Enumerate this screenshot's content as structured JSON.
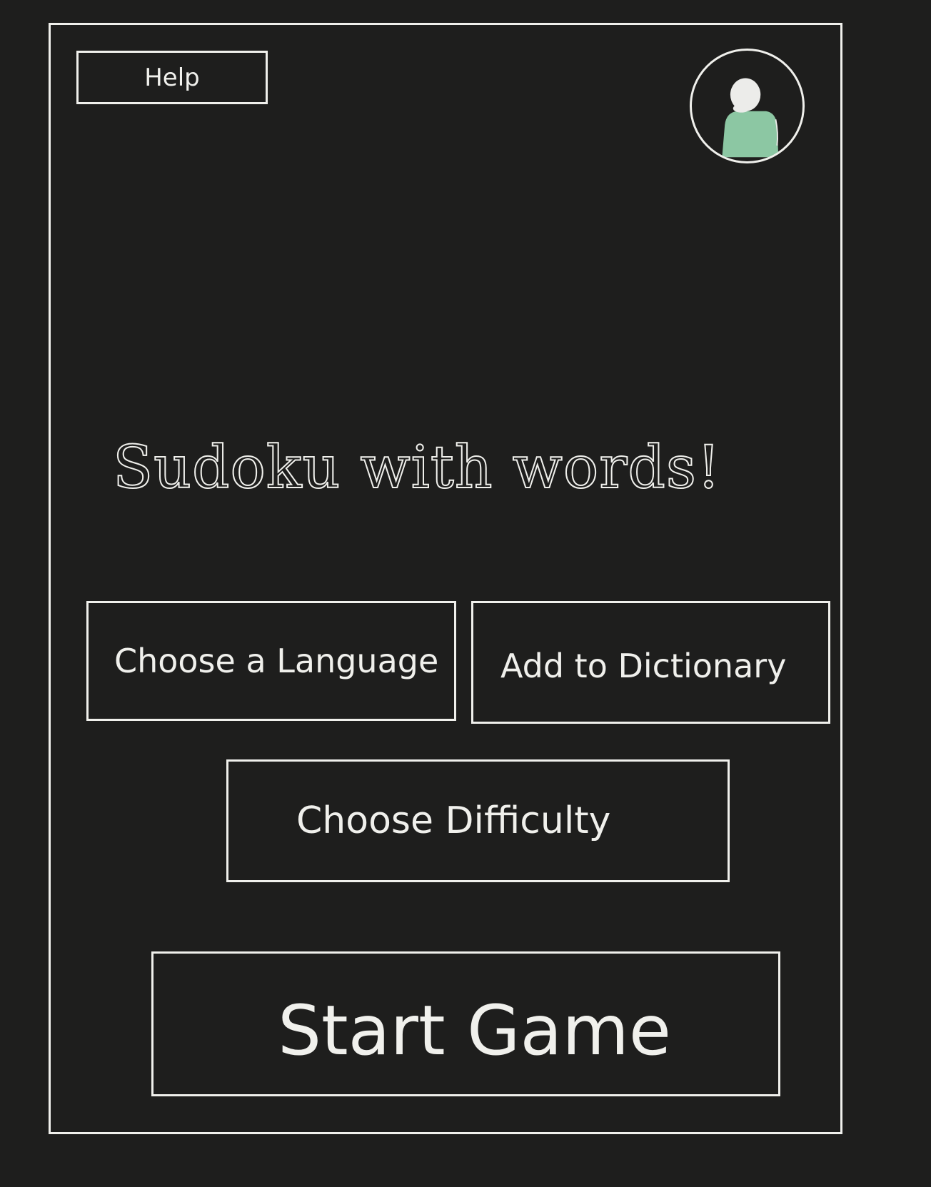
{
  "header": {
    "help_label": "Help",
    "avatar_icon": "user-avatar-icon"
  },
  "main": {
    "title": "Sudoku with words!",
    "buttons": {
      "language_label": "Choose a Language",
      "dictionary_label": "Add to Dictionary",
      "difficulty_label": "Choose Difficulty",
      "start_label": "Start Game"
    }
  },
  "colors": {
    "background": "#1e1e1d",
    "foreground": "#f0f0ec",
    "avatar_body": "#8cc7a3",
    "avatar_head": "#ececea"
  }
}
